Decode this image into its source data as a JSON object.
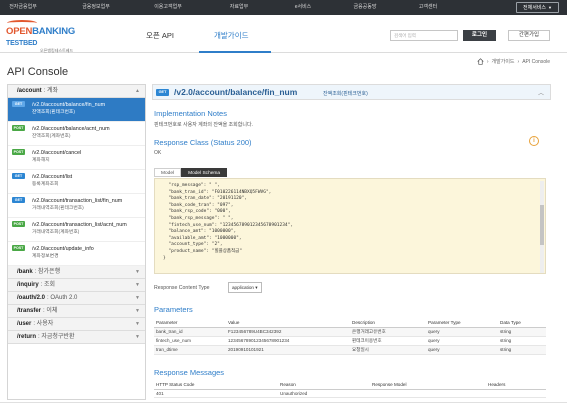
{
  "topnav": {
    "items": [
      "전자금융업무",
      "금융정보업무",
      "이용고객업무",
      "자료업무",
      "e서비스",
      "금융공동망",
      "고객센터"
    ],
    "all_services": "전체서비스"
  },
  "header": {
    "logo": {
      "open": "OPEN",
      "banking": "BANKING",
      "testbed": "TESTBED",
      "sub": "오픈뱅킹테스트베드"
    },
    "nav": {
      "openapi": "오픈 API",
      "devguide": "개발가이드"
    },
    "search_placeholder": "검색어 입력",
    "login": "로그인",
    "join": "간편가입"
  },
  "page": {
    "title": "API Console",
    "breadcrumb": [
      "개발가이드",
      "API Console"
    ]
  },
  "sidebar": {
    "groups": [
      {
        "path": "/account",
        "desc": ": 계좌"
      },
      {
        "path": "/bank",
        "desc": ": 참가은행"
      },
      {
        "path": "/inquiry",
        "desc": ": 조회"
      },
      {
        "path": "/oauth/2.0",
        "desc": ": OAuth 2.0"
      },
      {
        "path": "/transfer",
        "desc": ": 이체"
      },
      {
        "path": "/user",
        "desc": ": 사용자"
      },
      {
        "path": "/return",
        "desc": ": 자금청구반환"
      }
    ],
    "items": [
      {
        "method": "GET",
        "path": "/v2.0/account/balance/fin_num",
        "desc": "잔액조회(핀테크번호)"
      },
      {
        "method": "POST",
        "path": "/v2.0/account/balance/acnt_num",
        "desc": "잔액조회(계좌번호)"
      },
      {
        "method": "POST",
        "path": "/v2.0/account/cancel",
        "desc": "계좌해지"
      },
      {
        "method": "GET",
        "path": "/v2.0/account/list",
        "desc": "등록계좌조회"
      },
      {
        "method": "GET",
        "path": "/v2.0/account/transaction_list/fin_num",
        "desc": "거래내역조회(핀테크번호)"
      },
      {
        "method": "POST",
        "path": "/v2.0/account/transaction_list/acnt_num",
        "desc": "거래내역조회(계좌번호)"
      },
      {
        "method": "POST",
        "path": "/v2.0/account/update_info",
        "desc": "계좌정보변경"
      }
    ]
  },
  "endpoint": {
    "method": "GET",
    "path": "/v2.0/account/balance/fin_num",
    "desc": "잔액조회(핀테크번호)"
  },
  "impl": {
    "title": "Implementation Notes",
    "text": "핀테크번호로 사용자 계좌의 잔액을 조회합니다."
  },
  "response_class": {
    "title": "Response Class (Status 200)",
    "status": "OK",
    "tab_model": "Model",
    "tab_schema": "Model Schema",
    "schema_lines": [
      "  \"rsp_message\": \" \",",
      "  \"bank_tran_id\": \"F010226114NBXQ5FWVG\",",
      "  \"bank_tran_date\": \"20191120\",",
      "  \"bank_code_tran\": \"097\",",
      "  \"bank_rsp_code\": \"000\",",
      "  \"bank_rsp_message\": \" \",",
      "  \"fintech_use_num\": \"123456789012345678901234\",",
      "  \"balance_amt\": \"1000000\",",
      "  \"available_amt\": \"1000000\",",
      "  \"account_type\": \"2\",",
      "  \"product_name\": \"힐플상품적금\"",
      "}"
    ]
  },
  "content_type": {
    "label": "Response Content Type",
    "value": "application"
  },
  "parameters": {
    "title": "Parameters",
    "headers": [
      "Parameter",
      "Value",
      "Description",
      "Parameter Type",
      "Data Type"
    ],
    "rows": [
      [
        "bank_tran_id",
        "F123456789U4BC342392",
        "은행거래고유번호",
        "query",
        "string"
      ],
      [
        "fintech_use_num",
        "123456789012345678901234",
        "핀테크이용번호",
        "query",
        "string"
      ],
      [
        "tran_dtime",
        "20190910101921",
        "요청일시",
        "query",
        "string"
      ]
    ]
  },
  "response_messages": {
    "title": "Response Messages",
    "headers": [
      "HTTP Status Code",
      "Reason",
      "Response Model",
      "Headers"
    ],
    "rows": [
      [
        "401",
        "Unauthorized",
        "",
        ""
      ]
    ]
  },
  "colors": {
    "accent": "#2f7ec9",
    "selected": "#2e7bc4",
    "get": "#2c86d3",
    "post": "#4aa846",
    "logo_orange": "#e2582f"
  }
}
